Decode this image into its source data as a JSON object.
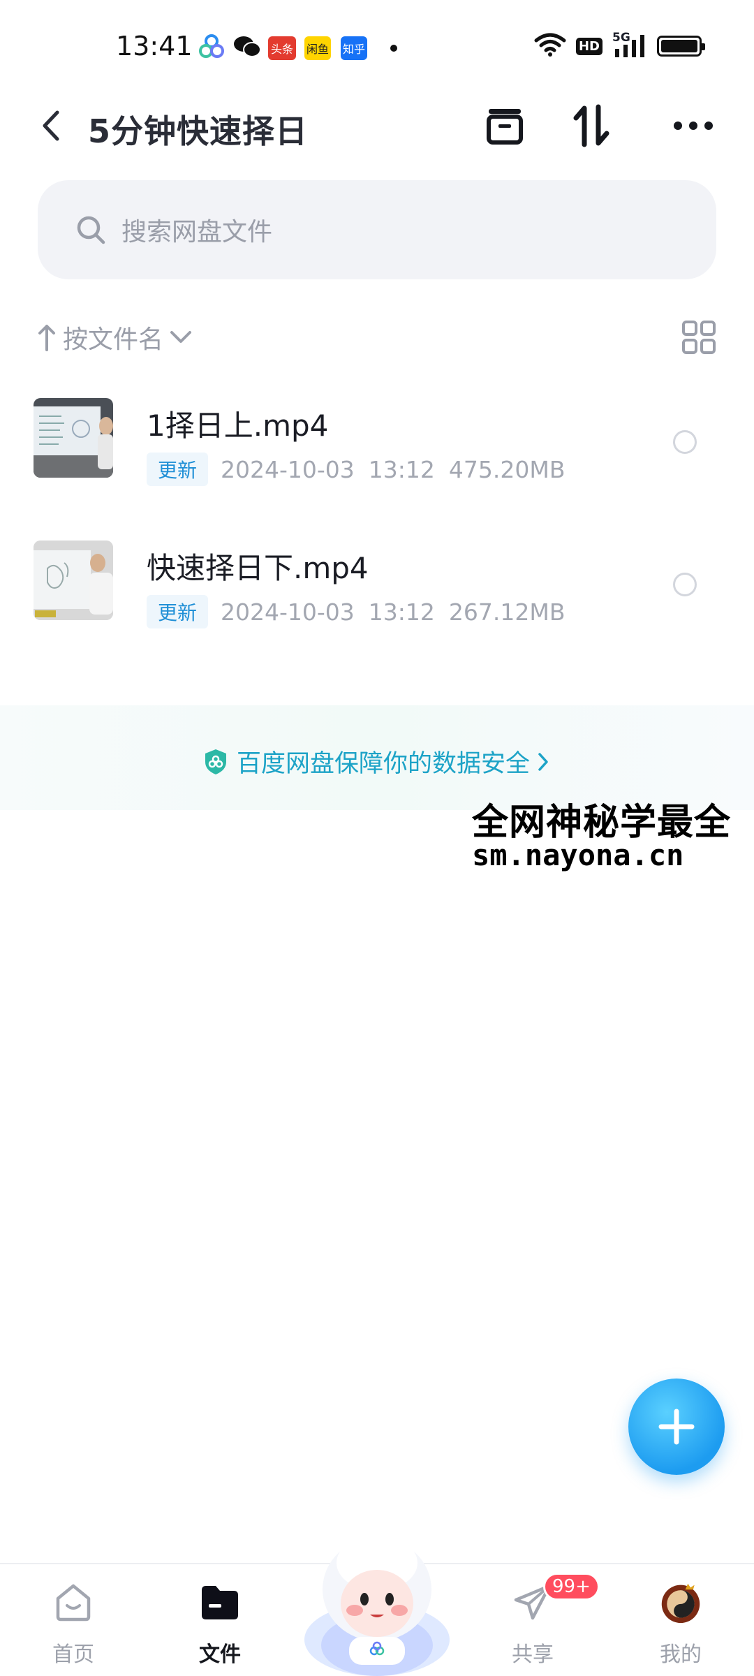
{
  "status_bar": {
    "time": "13:41",
    "apps": [
      "头条",
      "闲鱼",
      "知乎"
    ],
    "network": "5G",
    "hd": "HD"
  },
  "header": {
    "title": "5分钟快速择日"
  },
  "search": {
    "placeholder": "搜索网盘文件"
  },
  "sort": {
    "label": "按文件名"
  },
  "files": [
    {
      "name": "1择日上.mp4",
      "tag": "更新",
      "date": "2024-10-03",
      "time": "13:12",
      "size": "475.20MB"
    },
    {
      "name": "快速择日下.mp4",
      "tag": "更新",
      "date": "2024-10-03",
      "time": "13:12",
      "size": "267.12MB"
    }
  ],
  "security_banner": {
    "text": "百度网盘保障你的数据安全"
  },
  "watermark": {
    "line1": "全网神秘学最全",
    "line2": "sm.nayona.cn"
  },
  "bottom_nav": {
    "items": [
      {
        "label": "首页",
        "active": false
      },
      {
        "label": "文件",
        "active": true
      },
      {
        "label": "共享",
        "active": false,
        "badge": "99+"
      },
      {
        "label": "我的",
        "active": false
      }
    ]
  },
  "colors": {
    "accent": "#1d9cf0",
    "badge": "#ff4d5e",
    "security_text": "#1da3c7"
  }
}
